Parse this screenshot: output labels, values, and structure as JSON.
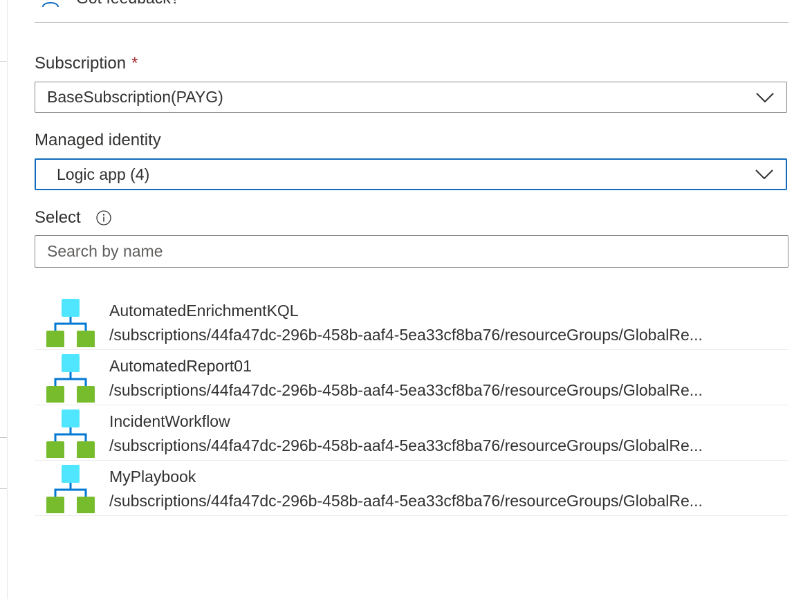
{
  "feedback": {
    "label": "Got feedback?"
  },
  "subscription": {
    "label": "Subscription",
    "required_mark": "*",
    "value": "BaseSubscription(PAYG)"
  },
  "managed_identity": {
    "label": "Managed identity",
    "value": "Logic app (4)"
  },
  "select": {
    "label": "Select",
    "search_placeholder": "Search by name"
  },
  "items": [
    {
      "name": "AutomatedEnrichmentKQL",
      "path": "/subscriptions/44fa47dc-296b-458b-aaf4-5ea33cf8ba76/resourceGroups/GlobalRe..."
    },
    {
      "name": "AutomatedReport01",
      "path": "/subscriptions/44fa47dc-296b-458b-aaf4-5ea33cf8ba76/resourceGroups/GlobalRe..."
    },
    {
      "name": "IncidentWorkflow",
      "path": "/subscriptions/44fa47dc-296b-458b-aaf4-5ea33cf8ba76/resourceGroups/GlobalRe..."
    },
    {
      "name": "MyPlaybook",
      "path": "/subscriptions/44fa47dc-296b-458b-aaf4-5ea33cf8ba76/resourceGroups/GlobalRe..."
    }
  ],
  "colors": {
    "focus_border": "#0f6cbd",
    "required": "#a4262c",
    "icon_top_block": "#50e6ff",
    "icon_bottom_block": "#76bc2d",
    "icon_connector": "#0078d4"
  }
}
